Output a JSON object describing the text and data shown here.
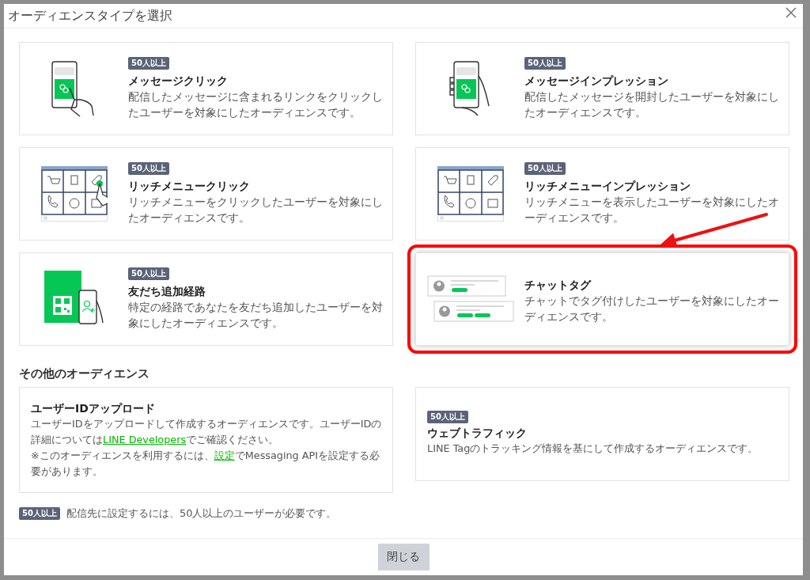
{
  "window": {
    "title": "オーディエンスタイプを選択"
  },
  "cards": [
    {
      "kind": "message-click",
      "badge": "50人以上",
      "title": "メッセージクリック",
      "description": "配信したメッセージに含まれるリンクをクリックしたユーザーを対象にしたオーディエンスです。",
      "highlighted": false
    },
    {
      "kind": "message-impression",
      "badge": "50人以上",
      "title": "メッセージインプレッション",
      "description": "配信したメッセージを開封したユーザーを対象にしたオーディエンスです。",
      "highlighted": false
    },
    {
      "kind": "richmenu-click",
      "badge": "50人以上",
      "title": "リッチメニュークリック",
      "description": "リッチメニューをクリックしたユーザーを対象にしたオーディエンスです。",
      "highlighted": false
    },
    {
      "kind": "richmenu-impression",
      "badge": "50人以上",
      "title": "リッチメニューインプレッション",
      "description": "リッチメニューを表示したユーザーを対象にしたオーディエンスです。",
      "highlighted": false
    },
    {
      "kind": "friend-path",
      "badge": "50人以上",
      "title": "友だち追加経路",
      "description": "特定の経路であなたを友だち追加したユーザーを対象にしたオーディエンスです。",
      "highlighted": false
    },
    {
      "kind": "chat-tag",
      "title": "チャットタグ",
      "description": "チャットでタグ付けしたユーザーを対象にしたオーディエンスです。",
      "highlighted": true
    }
  ],
  "other_section": {
    "heading": "その他のオーディエンス",
    "cards": [
      {
        "title": "ユーザーIDアップロード",
        "paragraphs": [
          [
            {
              "text": "ユーザーIDをアップロードして作成するオーディエンスです。ユーザーIDの詳細については",
              "link": false
            },
            {
              "text": "LINE Developers",
              "link": true
            },
            {
              "text": "でご確認ください。",
              "link": false
            }
          ],
          [
            {
              "text": "※このオーディエンスを利用するには、",
              "link": false
            },
            {
              "text": "設定",
              "link": true
            },
            {
              "text": "でMessaging APIを設定する必要があります。",
              "link": false
            }
          ]
        ]
      },
      {
        "badge": "50人以上",
        "title": "ウェブトラフィック",
        "paragraphs": [
          [
            {
              "text": "LINE Tagのトラッキング情報を基にして作成するオーディエンスです。",
              "link": false
            }
          ]
        ]
      }
    ]
  },
  "note": {
    "badge": "50人以上",
    "text": "配信先に設定するには、50人以上のユーザーが必要です。"
  },
  "buttons": [
    "閉じる"
  ]
}
